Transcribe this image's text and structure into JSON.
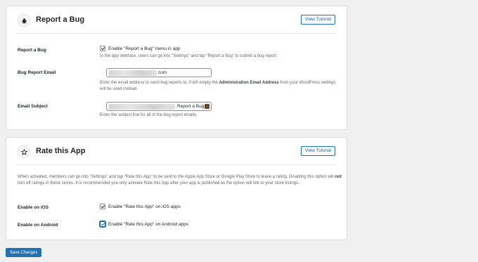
{
  "report_bug": {
    "title": "Report a Bug",
    "icon": "bug-icon",
    "tutorial_label": "View Tutorial",
    "rows": {
      "enable": {
        "label": "Report a Bug",
        "checkbox_label": "Enable \"Report a Bug\" menu in app",
        "checked": true,
        "description": "In the app interface, users can go into \"Settings\" and tap \"Report a Bug\" to submit a bug report."
      },
      "email": {
        "label": "Bug Report Email",
        "value_suffix": "com",
        "description_before": "Enter the email address to send bug reports to. If left empty the ",
        "description_bold": "Administration Email Address",
        "description_after": " from your WordPress settings will be used instead."
      },
      "subject": {
        "label": "Email Subject",
        "value_suffix": "Report a Bug",
        "description": "Enter the subject line for all of the bug report emails."
      }
    }
  },
  "rate_app": {
    "title": "Rate this App",
    "icon": "star-icon",
    "tutorial_label": "View Tutorial",
    "intro_before": "When activated, members can go into \"Settings\" and tap \"Rate this App\" to be sent to the Apple App Store or Google Play Store to leave a rating. Disabling this option will ",
    "intro_em": "not",
    "intro_after": " turn off ratings in these stores. It is recommended you only activate Rate this App after your app is published as the option will link to your store listings.",
    "ios": {
      "label": "Enable on iOS",
      "checkbox_label": "Enable \"Rate this App\" on iOS apps",
      "checked": true
    },
    "android": {
      "label": "Enable on Android",
      "checkbox_label": "Enable \"Rate this App\" on Android apps",
      "checked": true
    }
  },
  "save_label": "Save Changes",
  "colors": {
    "accent": "#2271b1",
    "background": "#f0f0f1",
    "panel": "#ffffff"
  }
}
